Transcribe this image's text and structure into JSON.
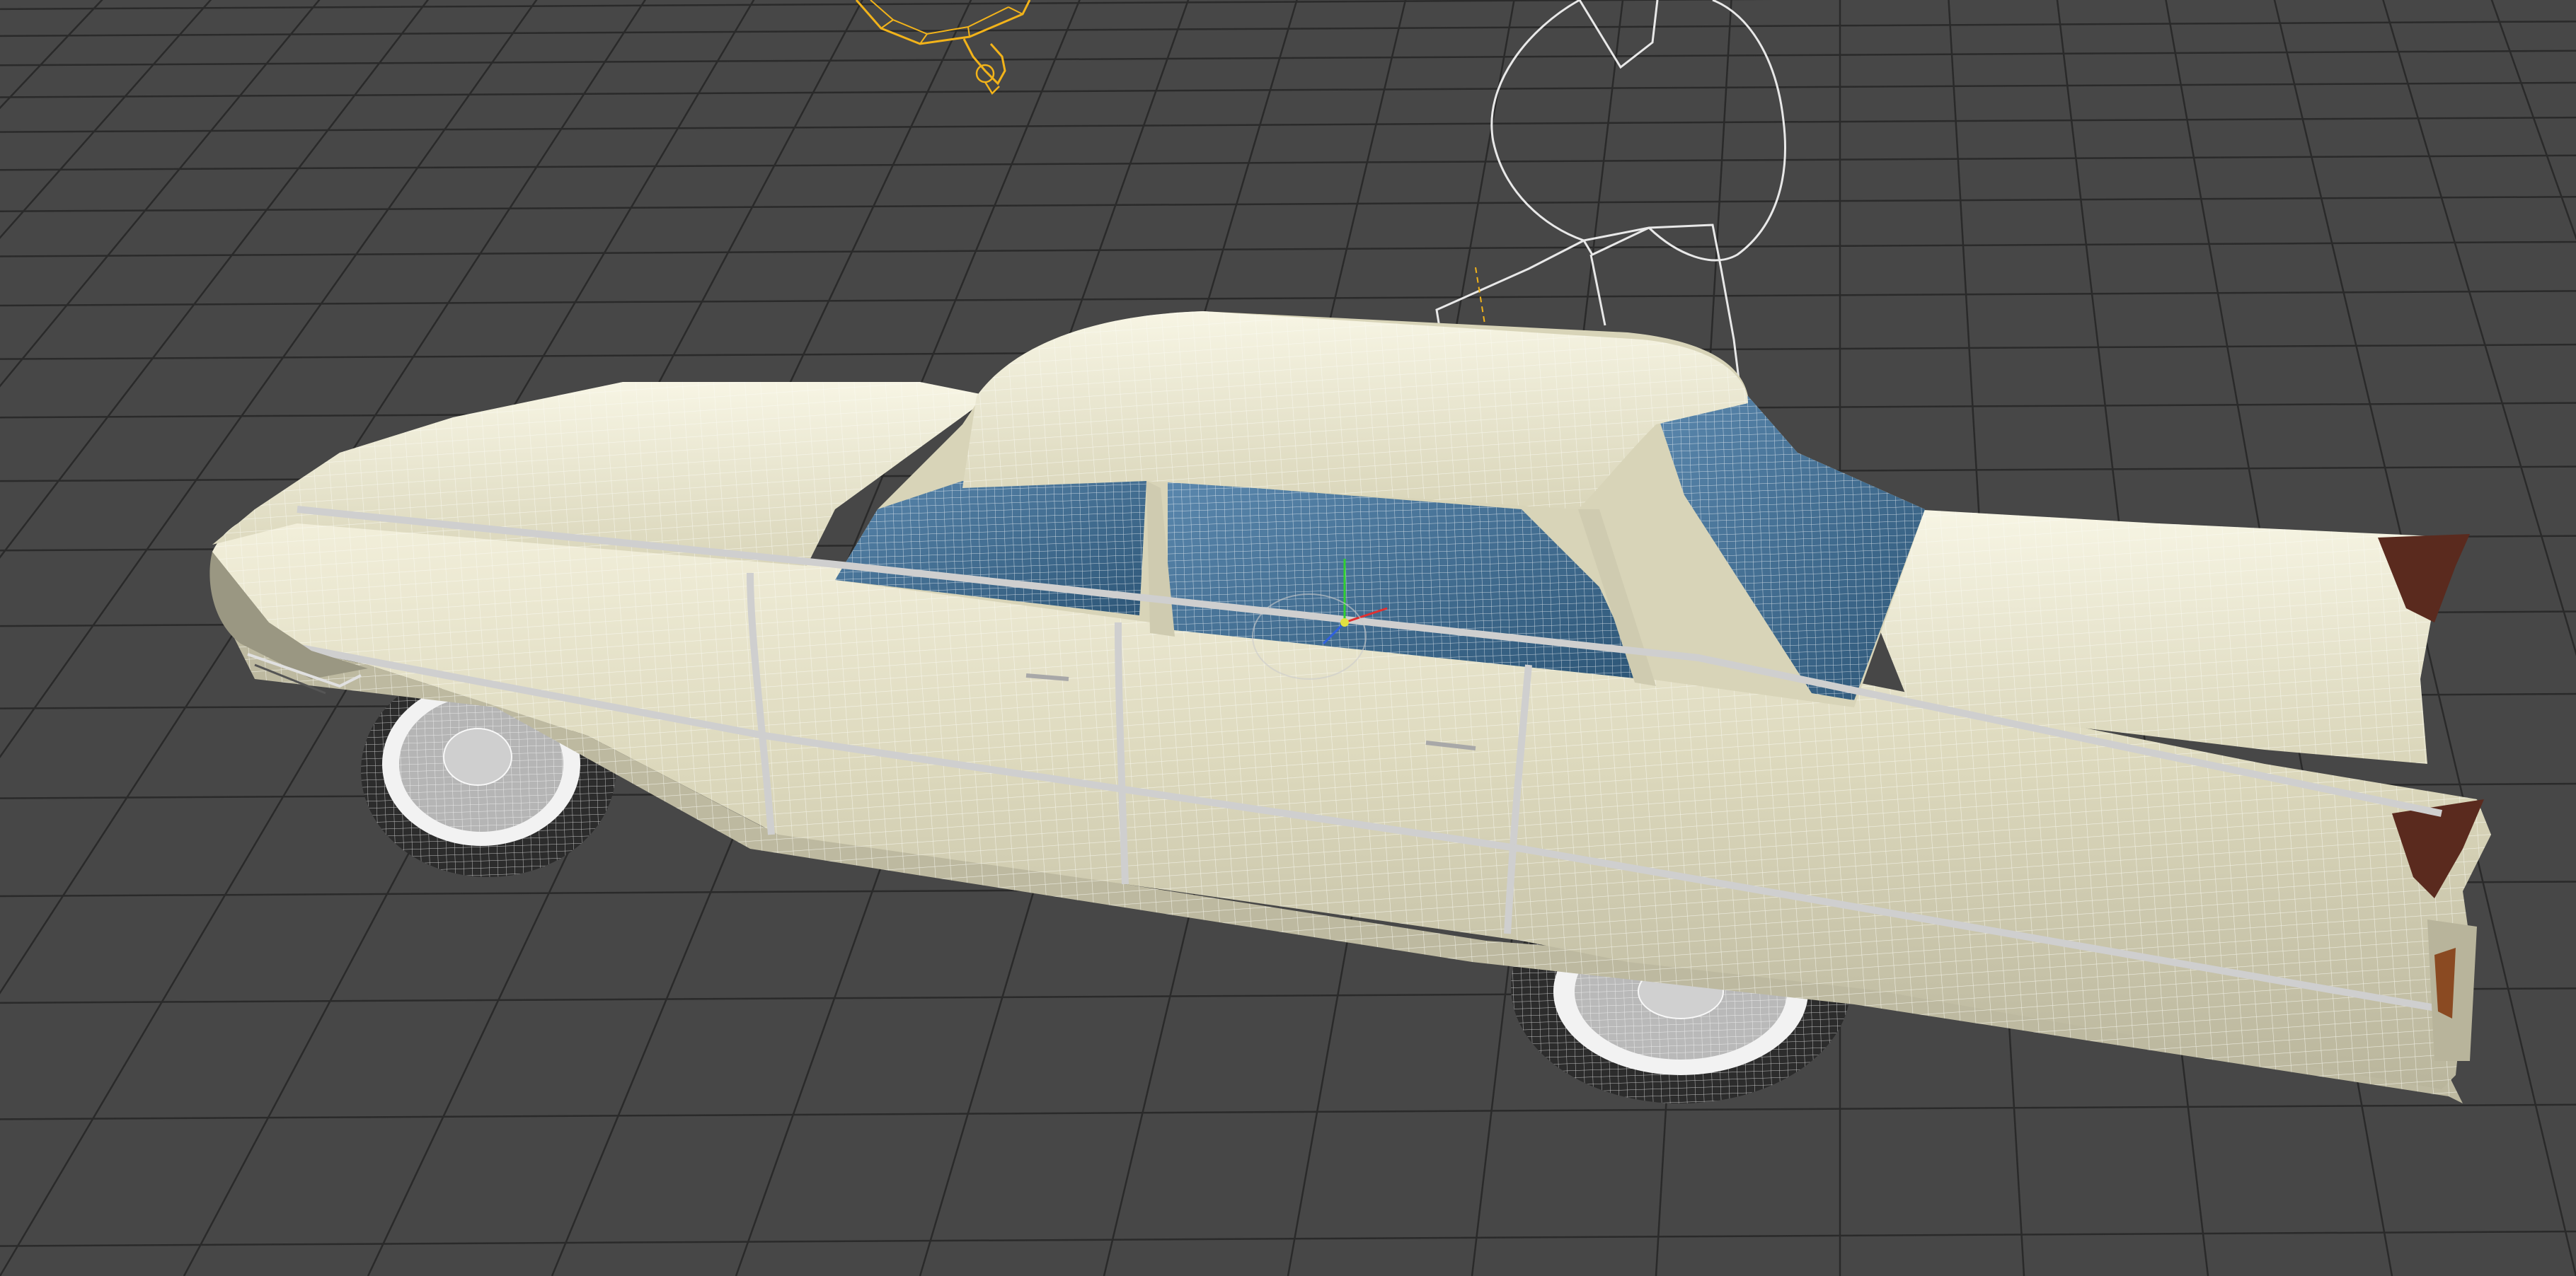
{
  "viewport": {
    "background_color": "#474747",
    "grid_color": "#2a2a2a",
    "shading_mode": "wireframe-on-shaded"
  },
  "scene": {
    "car_model": {
      "body_color": "#e6e2c8",
      "wire_color": "#fafaf0",
      "glass_color": "#3a6b93",
      "tire_color": "#2c2c2c",
      "whitewall_color": "#f2f2f2"
    },
    "camera_object": {
      "wire_color": "#f2b31a"
    },
    "light_object": {
      "wire_color": "#e8e8e8"
    },
    "transform_gizmo": {
      "x_axis_color": "#e03030",
      "y_axis_color": "#30d030",
      "z_axis_color": "#3060e0"
    },
    "icons": [
      "camera-wireframe-icon",
      "light-wireframe-icon",
      "transform-gizmo-icon"
    ]
  }
}
